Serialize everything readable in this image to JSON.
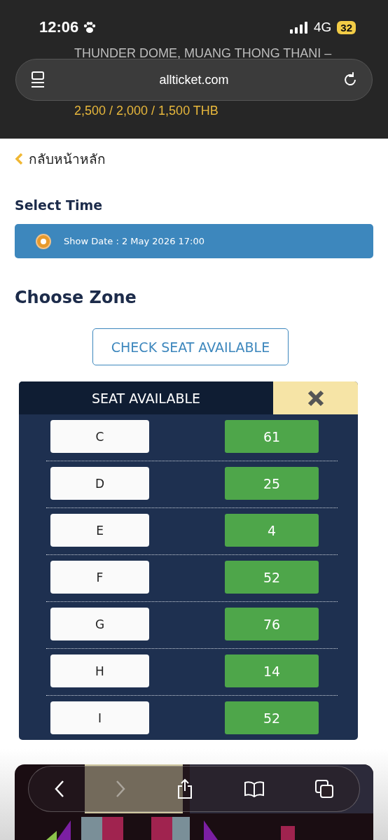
{
  "status_bar": {
    "time": "12:06",
    "network": "4G",
    "battery": "32"
  },
  "event": {
    "venue": "THUNDER DOME, MUANG THONG THANI –",
    "prices": "2,500 / 2,000 / 1,500 THB"
  },
  "address_bar": {
    "url": "allticket.com"
  },
  "back_link": "กลับหน้าหลัก",
  "select_time": {
    "title": "Select Time",
    "options": [
      {
        "label": "Show Date : 2 May 2026 17:00",
        "selected": true
      }
    ]
  },
  "choose_zone": {
    "title": "Choose Zone",
    "check_button": "CHECK SEAT AVAILABLE"
  },
  "seat_panel": {
    "title": "SEAT AVAILABLE",
    "rows": [
      {
        "zone": "C",
        "available": "61"
      },
      {
        "zone": "D",
        "available": "25"
      },
      {
        "zone": "E",
        "available": "4"
      },
      {
        "zone": "F",
        "available": "52"
      },
      {
        "zone": "G",
        "available": "76"
      },
      {
        "zone": "H",
        "available": "14"
      },
      {
        "zone": "I",
        "available": "52"
      }
    ]
  }
}
